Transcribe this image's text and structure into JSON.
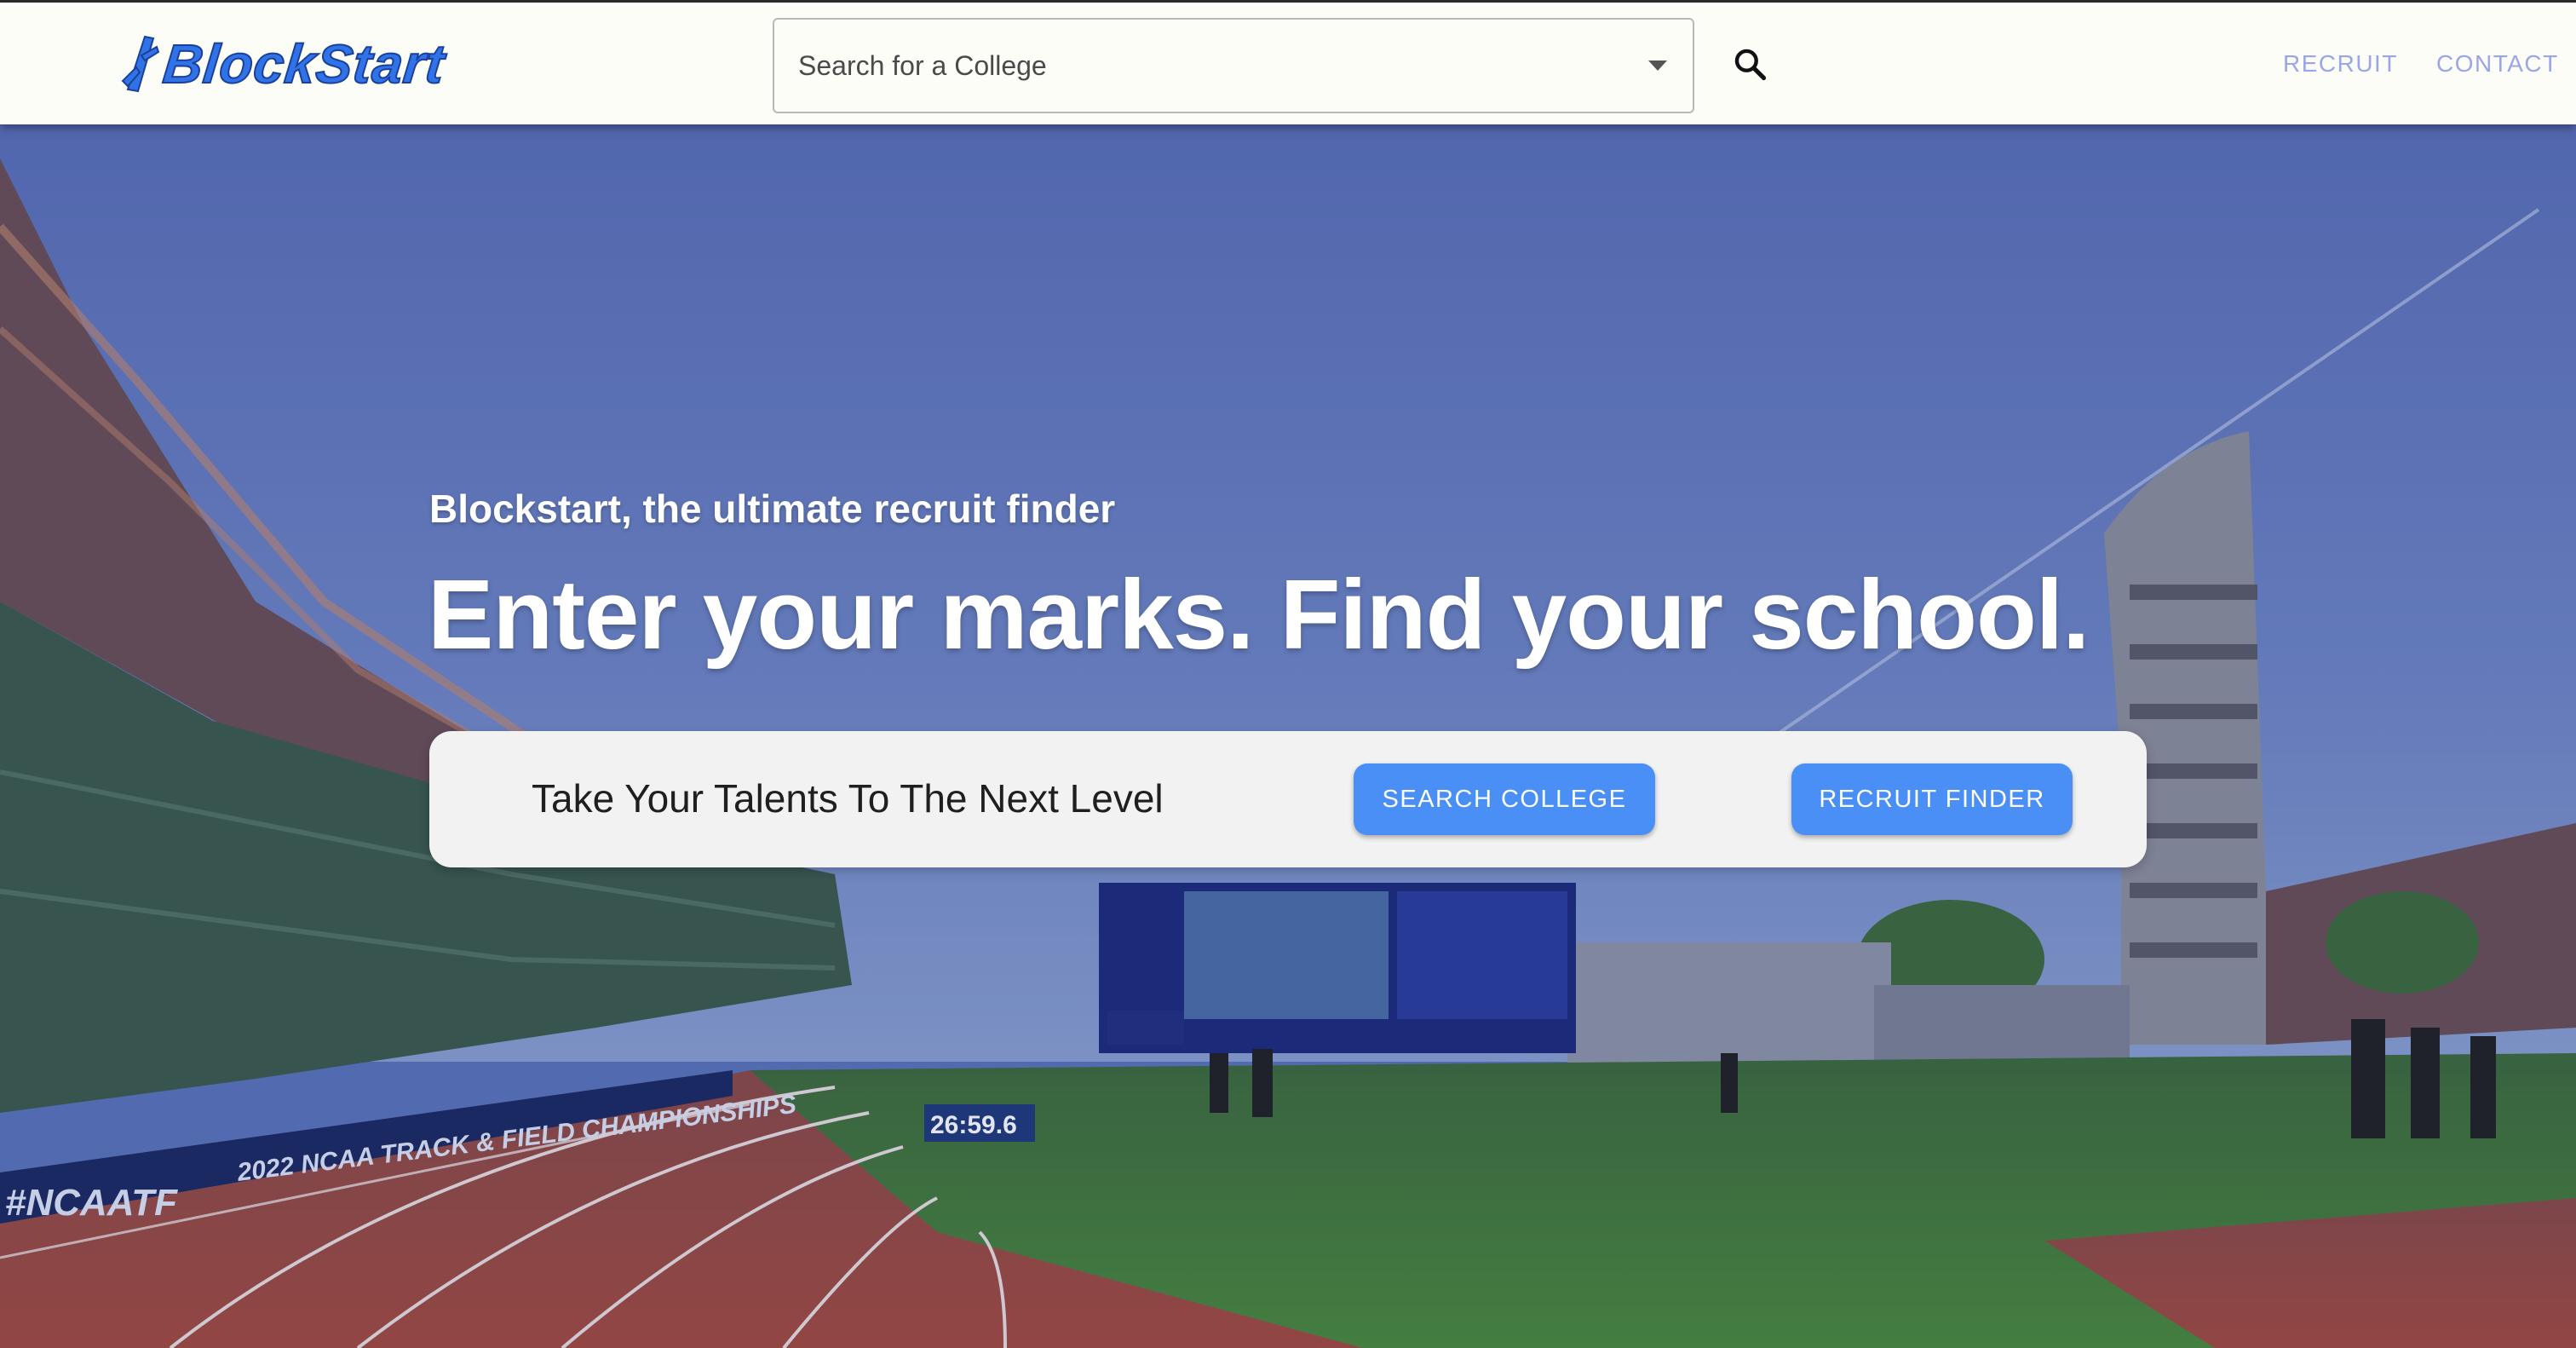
{
  "header": {
    "logo_text": "BlockStart",
    "search": {
      "value": "Search for a College"
    },
    "nav": {
      "recruit": "RECRUIT",
      "contact": "CONTACT"
    }
  },
  "hero": {
    "subtitle": "Blockstart, the ultimate recruit finder",
    "title": "Enter your marks. Find your school.",
    "cta": {
      "tagline": "Take Your Talents To The Next Level",
      "search_college": "SEARCH COLLEGE",
      "recruit_finder": "RECRUIT FINDER"
    },
    "scene": {
      "banner_text": "2022 NCAA TRACK & FIELD CHAMPIONSHIPS",
      "hashtag": "#NCAATF",
      "clock": "26:59.6"
    }
  },
  "colors": {
    "brand": "#2f73e6",
    "button": "#4a8ff5",
    "nav_link": "#9aa6e8",
    "header_bg": "#fdfdf8",
    "track": "#a04a3c",
    "field": "#3f7a35"
  },
  "icons": {
    "search": "search-icon",
    "dropdown": "caret-down-icon",
    "logo": "starting-block-icon"
  }
}
